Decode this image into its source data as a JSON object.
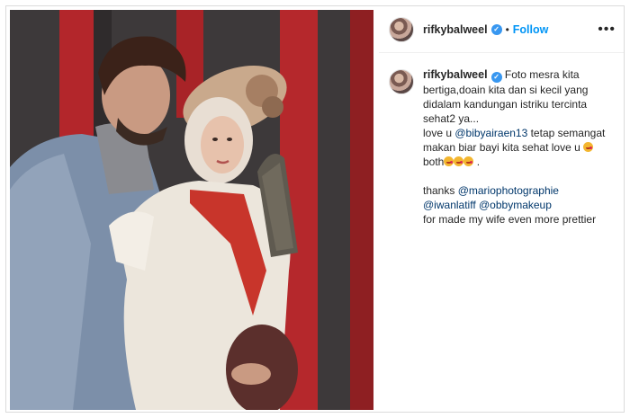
{
  "post": {
    "username": "rifkybalweel",
    "verified_glyph": "✓",
    "separator": "•",
    "follow_label": "Follow",
    "more_glyph": "•••",
    "icons": [
      "avatar",
      "verified-badge",
      "more-options-icon"
    ]
  },
  "caption": {
    "username": "rifkybalweel",
    "line1": " Foto mesra kita bertiga,doain kita dan si kecil yang didalam kandungan istriku tercinta sehat2 ya...",
    "love_prefix": "love u ",
    "mention1": "@bibyairaen13",
    "line2": " tetap semangat makan biar bayi kita sehat love u ",
    "both": " both",
    "period": " .",
    "thanks_prefix": "thanks ",
    "mention2": "@mariophotographie",
    "mention3": "@iwanlatiff",
    "mention4": "@obbymakeup",
    "closing": "for made my wife even more prettier"
  },
  "colors": {
    "link": "#00376b",
    "follow": "#0095f6",
    "verified": "#3897f0",
    "backdrop_red": "#b5262a",
    "backdrop_dark": "#3a3637"
  }
}
